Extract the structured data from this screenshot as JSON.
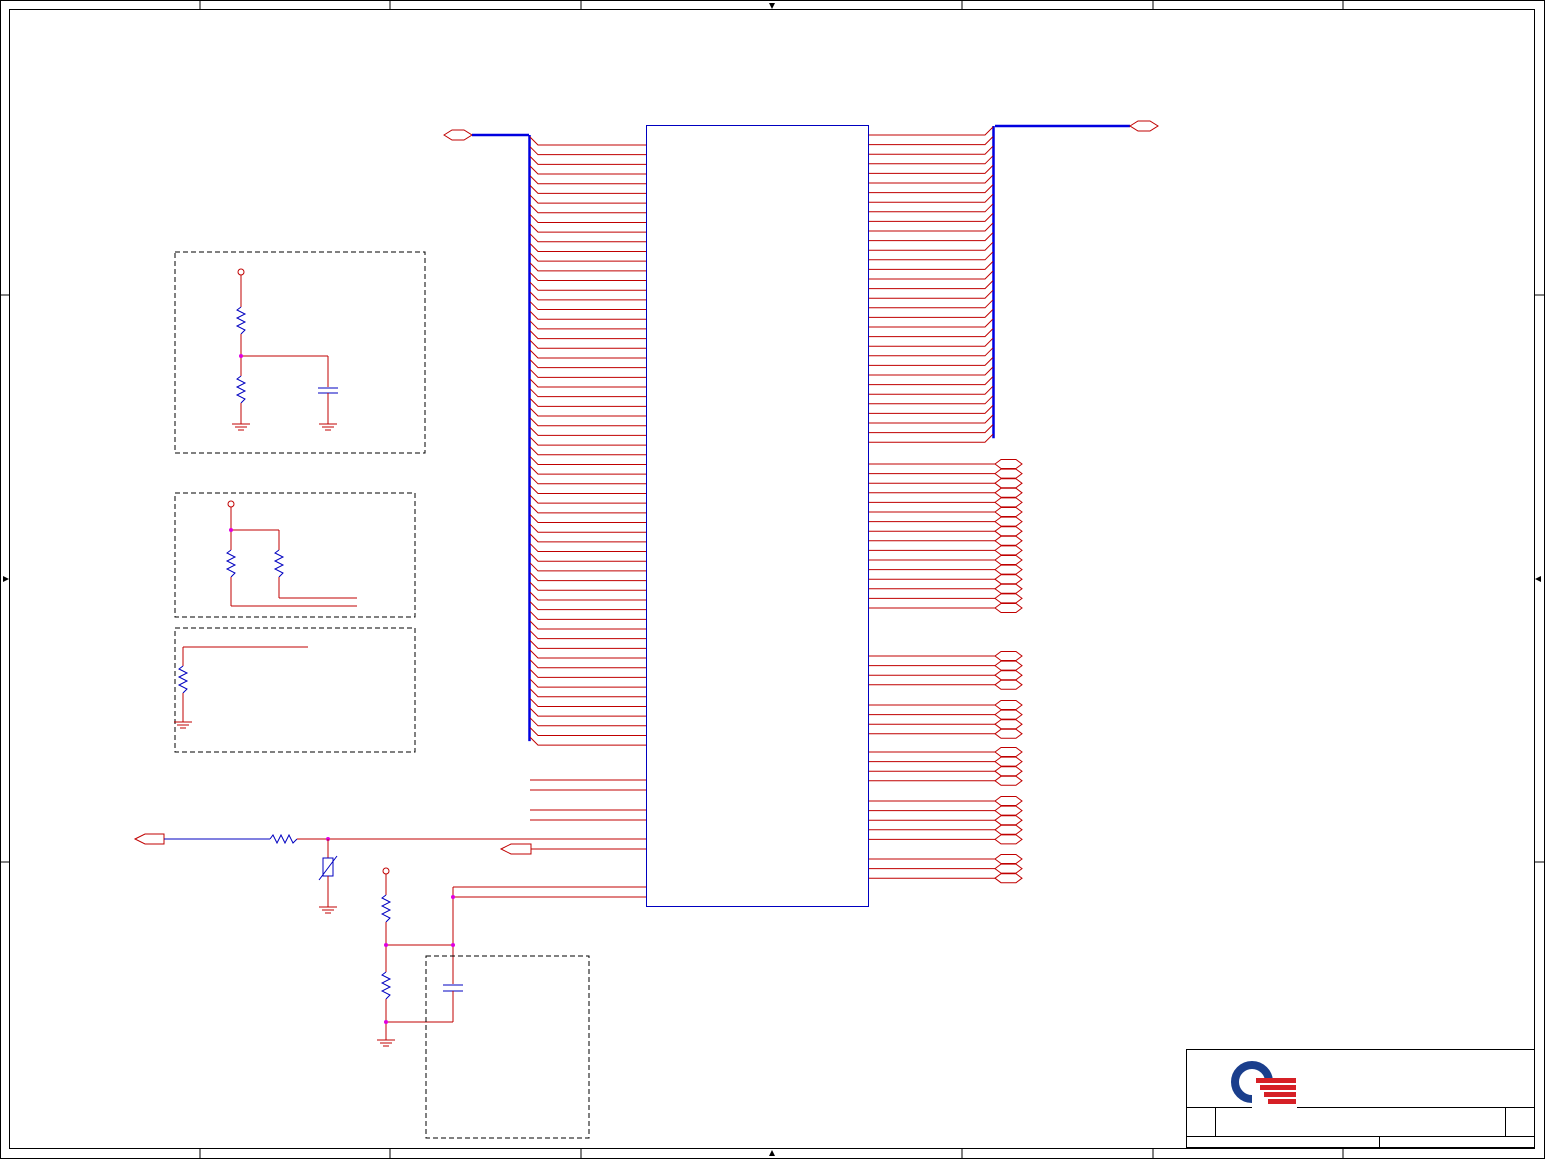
{
  "colors": {
    "frame": "#000000",
    "wire": "#c00000",
    "bus": "#0000e0",
    "component": "#0000c0",
    "junction": "#e000e0",
    "dashed_box": "#000000",
    "logo_blue": "#1a3e8c",
    "logo_red": "#d62026"
  },
  "icons": {
    "logo": "company-logo-icon",
    "resistor": "resistor-icon",
    "capacitor": "capacitor-icon",
    "ground": "ground-icon",
    "power": "power-pin-icon",
    "connector": "off-page-connector-icon",
    "varistor": "varistor-icon"
  },
  "schematic": {
    "left_bus_signal_count": 63,
    "right_bus_signal_count": 33,
    "right_port_groups": [
      16,
      4,
      4,
      4,
      5,
      3
    ],
    "left_single_signal_count": 5,
    "title_block_text": []
  }
}
